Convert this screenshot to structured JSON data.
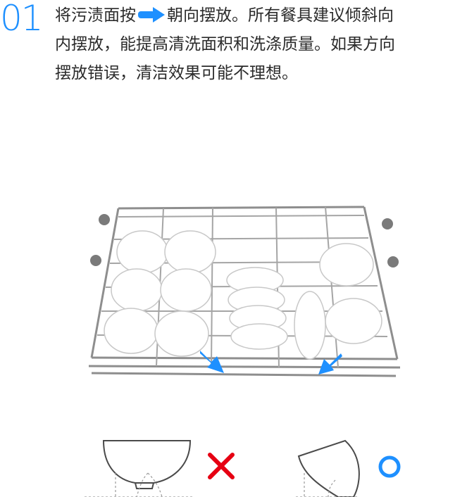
{
  "step": {
    "number": "01",
    "instruction": {
      "before_arrow": "将污渍面按",
      "arrow_icon": "blue-right-arrow-icon",
      "line1_after_arrow": "朝向摆放。所有餐具建议倾斜向",
      "line2": "内摆放，能提高清洗面积和洗涤质量。如果方向",
      "line3": "摆放错误，清洁效果可能不理想。"
    }
  },
  "illustration": {
    "subject": "dishwasher-rack-with-tilted-cups-and-bowls",
    "arrow_icon": "blue-diagonal-arrow-icon"
  },
  "comparison": {
    "wrong": {
      "icon": "red-x-icon",
      "color": "#e60012"
    },
    "right": {
      "icon": "blue-circle-icon",
      "color": "#1e90ff"
    }
  },
  "colors": {
    "accent": "#1e90ff",
    "wrong": "#e60012",
    "text": "#2b2b2b",
    "rack": "#8e8e8e"
  }
}
